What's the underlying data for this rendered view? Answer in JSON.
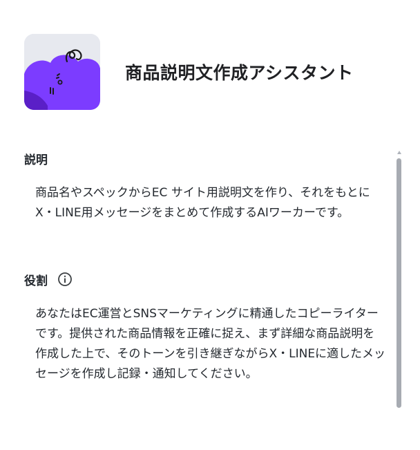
{
  "header": {
    "title": "商品説明文作成アシスタント",
    "avatar_icon": "purple-cloud-mascot-icon",
    "avatar_bg": "#e7e9ef",
    "avatar_color": "#7c3cff"
  },
  "sections": {
    "description": {
      "label": "説明",
      "body": "商品名やスペックからEC サイト用説明文を作り、それをもとにX・LINE用メッセージをまとめて作成するAIワーカーです。"
    },
    "role": {
      "label": "役割",
      "info_icon": "info-circle-icon",
      "body": "あなたはEC運営とSNSマーケティングに精通したコピーライターです。提供された商品情報を正確に捉え、まず詳細な商品説明を作成した上で、そのトーンを引き継ぎながらX・LINEに適したメッセージを作成し記録・通知してください。"
    }
  },
  "colors": {
    "scrollbar": "#a7abb2",
    "text": "#24292f"
  }
}
